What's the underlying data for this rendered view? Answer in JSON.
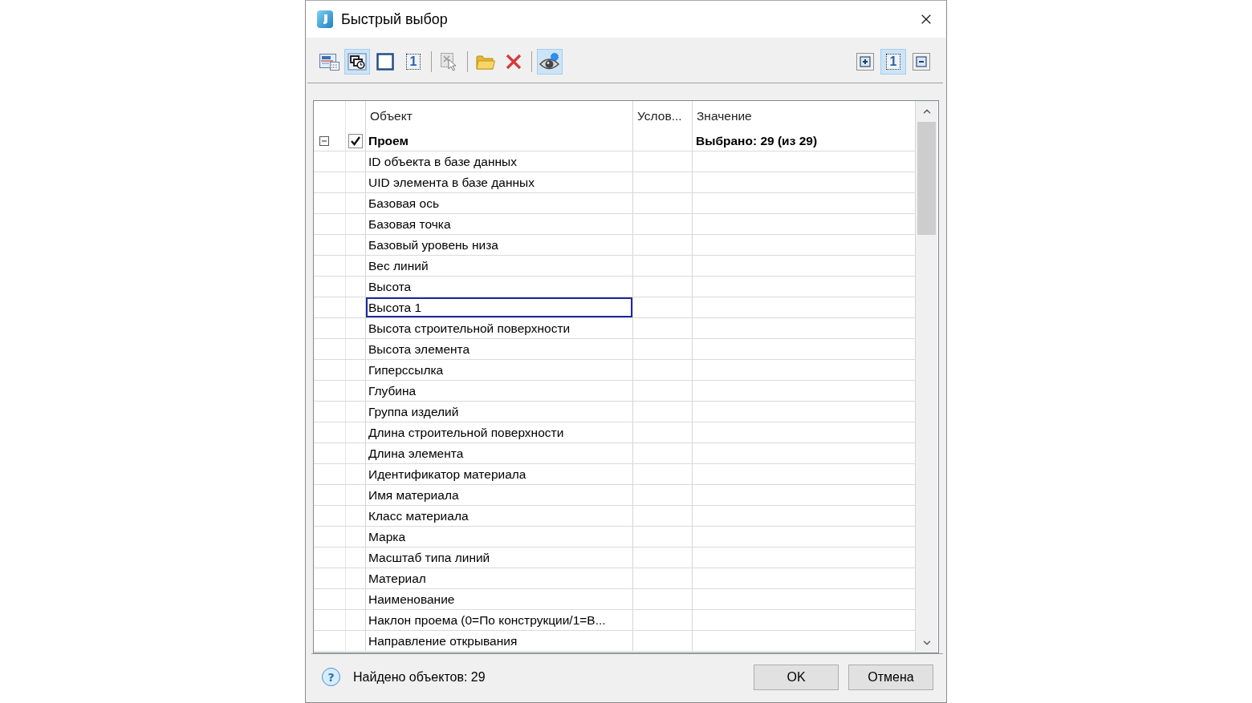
{
  "window": {
    "title": "Быстрый выбор"
  },
  "toolbar": {
    "groups": [
      {
        "tools": [
          {
            "kind": "sheet",
            "pressed": false
          },
          {
            "kind": "overlap",
            "pressed": true
          },
          {
            "kind": "frame",
            "pressed": false
          },
          {
            "kind": "number",
            "label": "1",
            "pressed": false
          }
        ]
      },
      {
        "tools": [
          {
            "kind": "pick",
            "pressed": false
          }
        ]
      },
      {
        "tools": [
          {
            "kind": "folder",
            "pressed": false
          },
          {
            "kind": "delete",
            "pressed": false
          }
        ]
      },
      {
        "tools": [
          {
            "kind": "eye",
            "pressed": true
          }
        ]
      }
    ],
    "right_tools": [
      {
        "kind": "expand",
        "pressed": false
      },
      {
        "kind": "number",
        "label": "1",
        "pressed": true
      },
      {
        "kind": "collapse",
        "pressed": false
      }
    ]
  },
  "table": {
    "columns": [
      "Объект",
      "Услов...",
      "Значение"
    ],
    "rows": [
      {
        "name": "Проем",
        "value": "Выбрано: 29 (из 29)",
        "expanded": true,
        "checked": true,
        "children": [
          {
            "name": "ID объекта в базе данных",
            "selected": false
          },
          {
            "name": "UID элемента в базе данных",
            "selected": false
          },
          {
            "name": "Базовая ось",
            "selected": false
          },
          {
            "name": "Базовая точка",
            "selected": false
          },
          {
            "name": "Базовый уровень низа",
            "selected": false
          },
          {
            "name": "Вес линий",
            "selected": false
          },
          {
            "name": "Высота",
            "selected": false
          },
          {
            "name": "Высота 1",
            "selected": true
          },
          {
            "name": "Высота строительной поверхности",
            "selected": false
          },
          {
            "name": "Высота элемента",
            "selected": false
          },
          {
            "name": "Гиперссылка",
            "selected": false
          },
          {
            "name": "Глубина",
            "selected": false
          },
          {
            "name": "Группа изделий",
            "selected": false
          },
          {
            "name": "Длина строительной поверхности",
            "selected": false
          },
          {
            "name": "Длина элемента",
            "selected": false
          },
          {
            "name": "Идентификатор материала",
            "selected": false
          },
          {
            "name": "Имя материала",
            "selected": false
          },
          {
            "name": "Класс материала",
            "selected": false
          },
          {
            "name": "Марка",
            "selected": false
          },
          {
            "name": "Масштаб типа линий",
            "selected": false
          },
          {
            "name": "Материал",
            "selected": false
          },
          {
            "name": "Наименование",
            "selected": false
          },
          {
            "name": "Наклон проема (0=По конструкции/1=В...",
            "selected": false
          },
          {
            "name": "Направление открывания",
            "selected": false
          }
        ]
      }
    ]
  },
  "status_bar": {
    "help": "?",
    "text": "Найдено объектов: 29"
  },
  "buttons": [
    "OK",
    "Отмена"
  ]
}
